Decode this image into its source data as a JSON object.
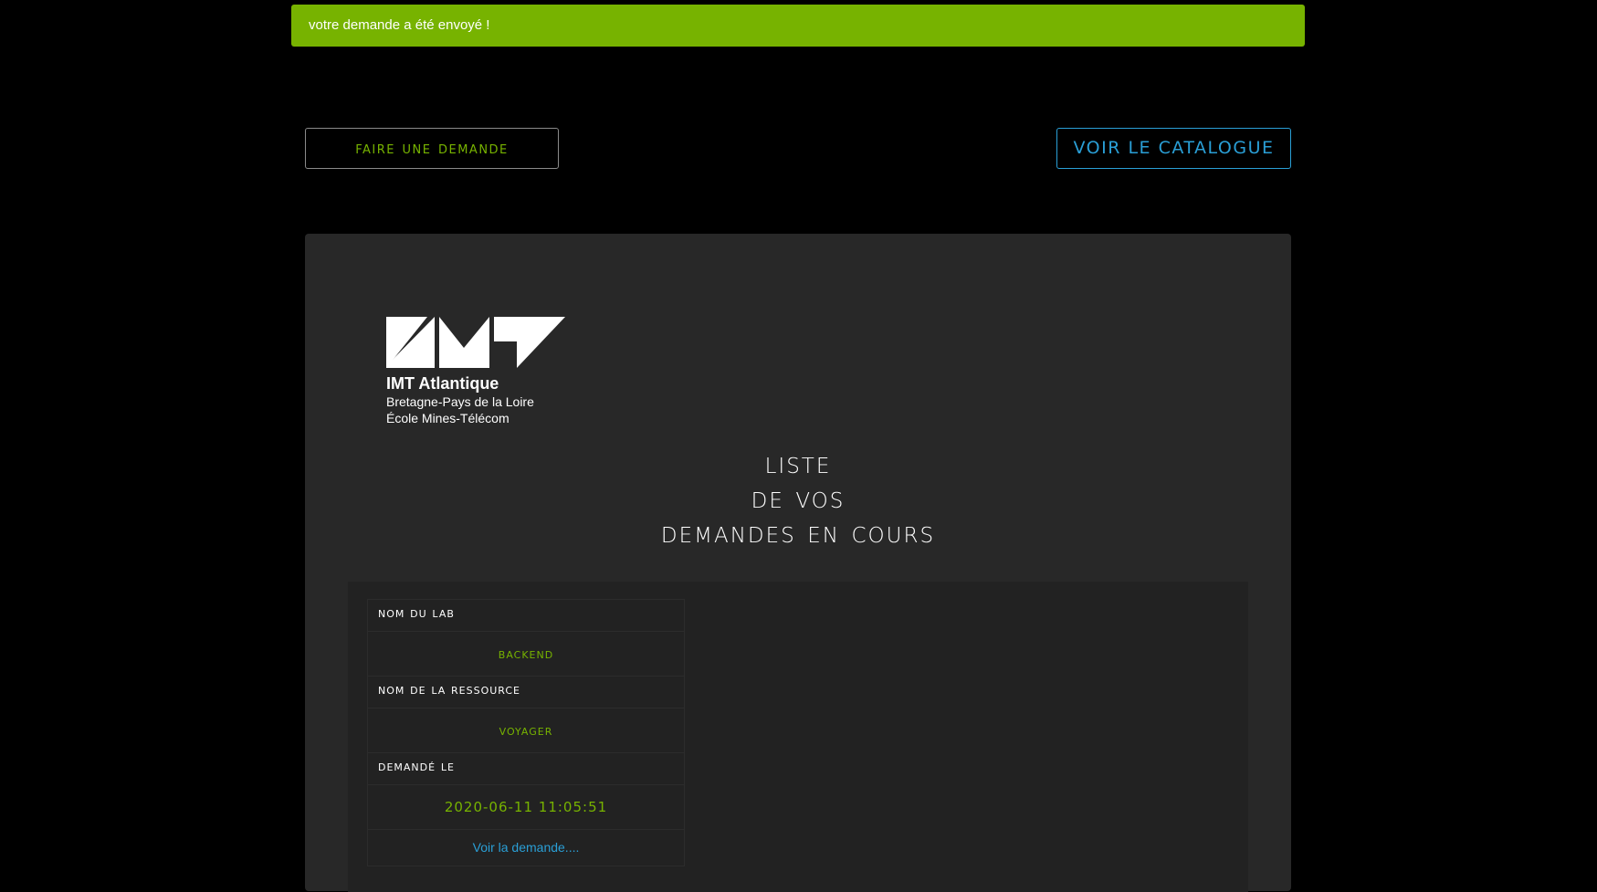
{
  "alert": {
    "message": "votre demande a été envoyé !"
  },
  "actions": {
    "request_button": "Faire une Demande",
    "catalog_button": "VOIR LE CATALOGUE"
  },
  "logo": {
    "name": "IMT Atlantique",
    "line1": "Bretagne-Pays de la Loire",
    "line2": "École Mines-Télécom"
  },
  "heading": {
    "line1": "Liste",
    "line2": "de vos",
    "line3": "Demandes en cours"
  },
  "request": {
    "lab_label": "Nom du Lab",
    "lab_value": "Backend",
    "resource_label": "Nom de la ressource",
    "resource_value": "voyager",
    "date_label": "Demandé le",
    "date_value": "2020-06-11 11:05:51",
    "link_text": "Voir la demande...."
  },
  "colors": {
    "accent_green": "#77b300",
    "accent_blue": "#2a9fd6",
    "panel": "#282828"
  }
}
